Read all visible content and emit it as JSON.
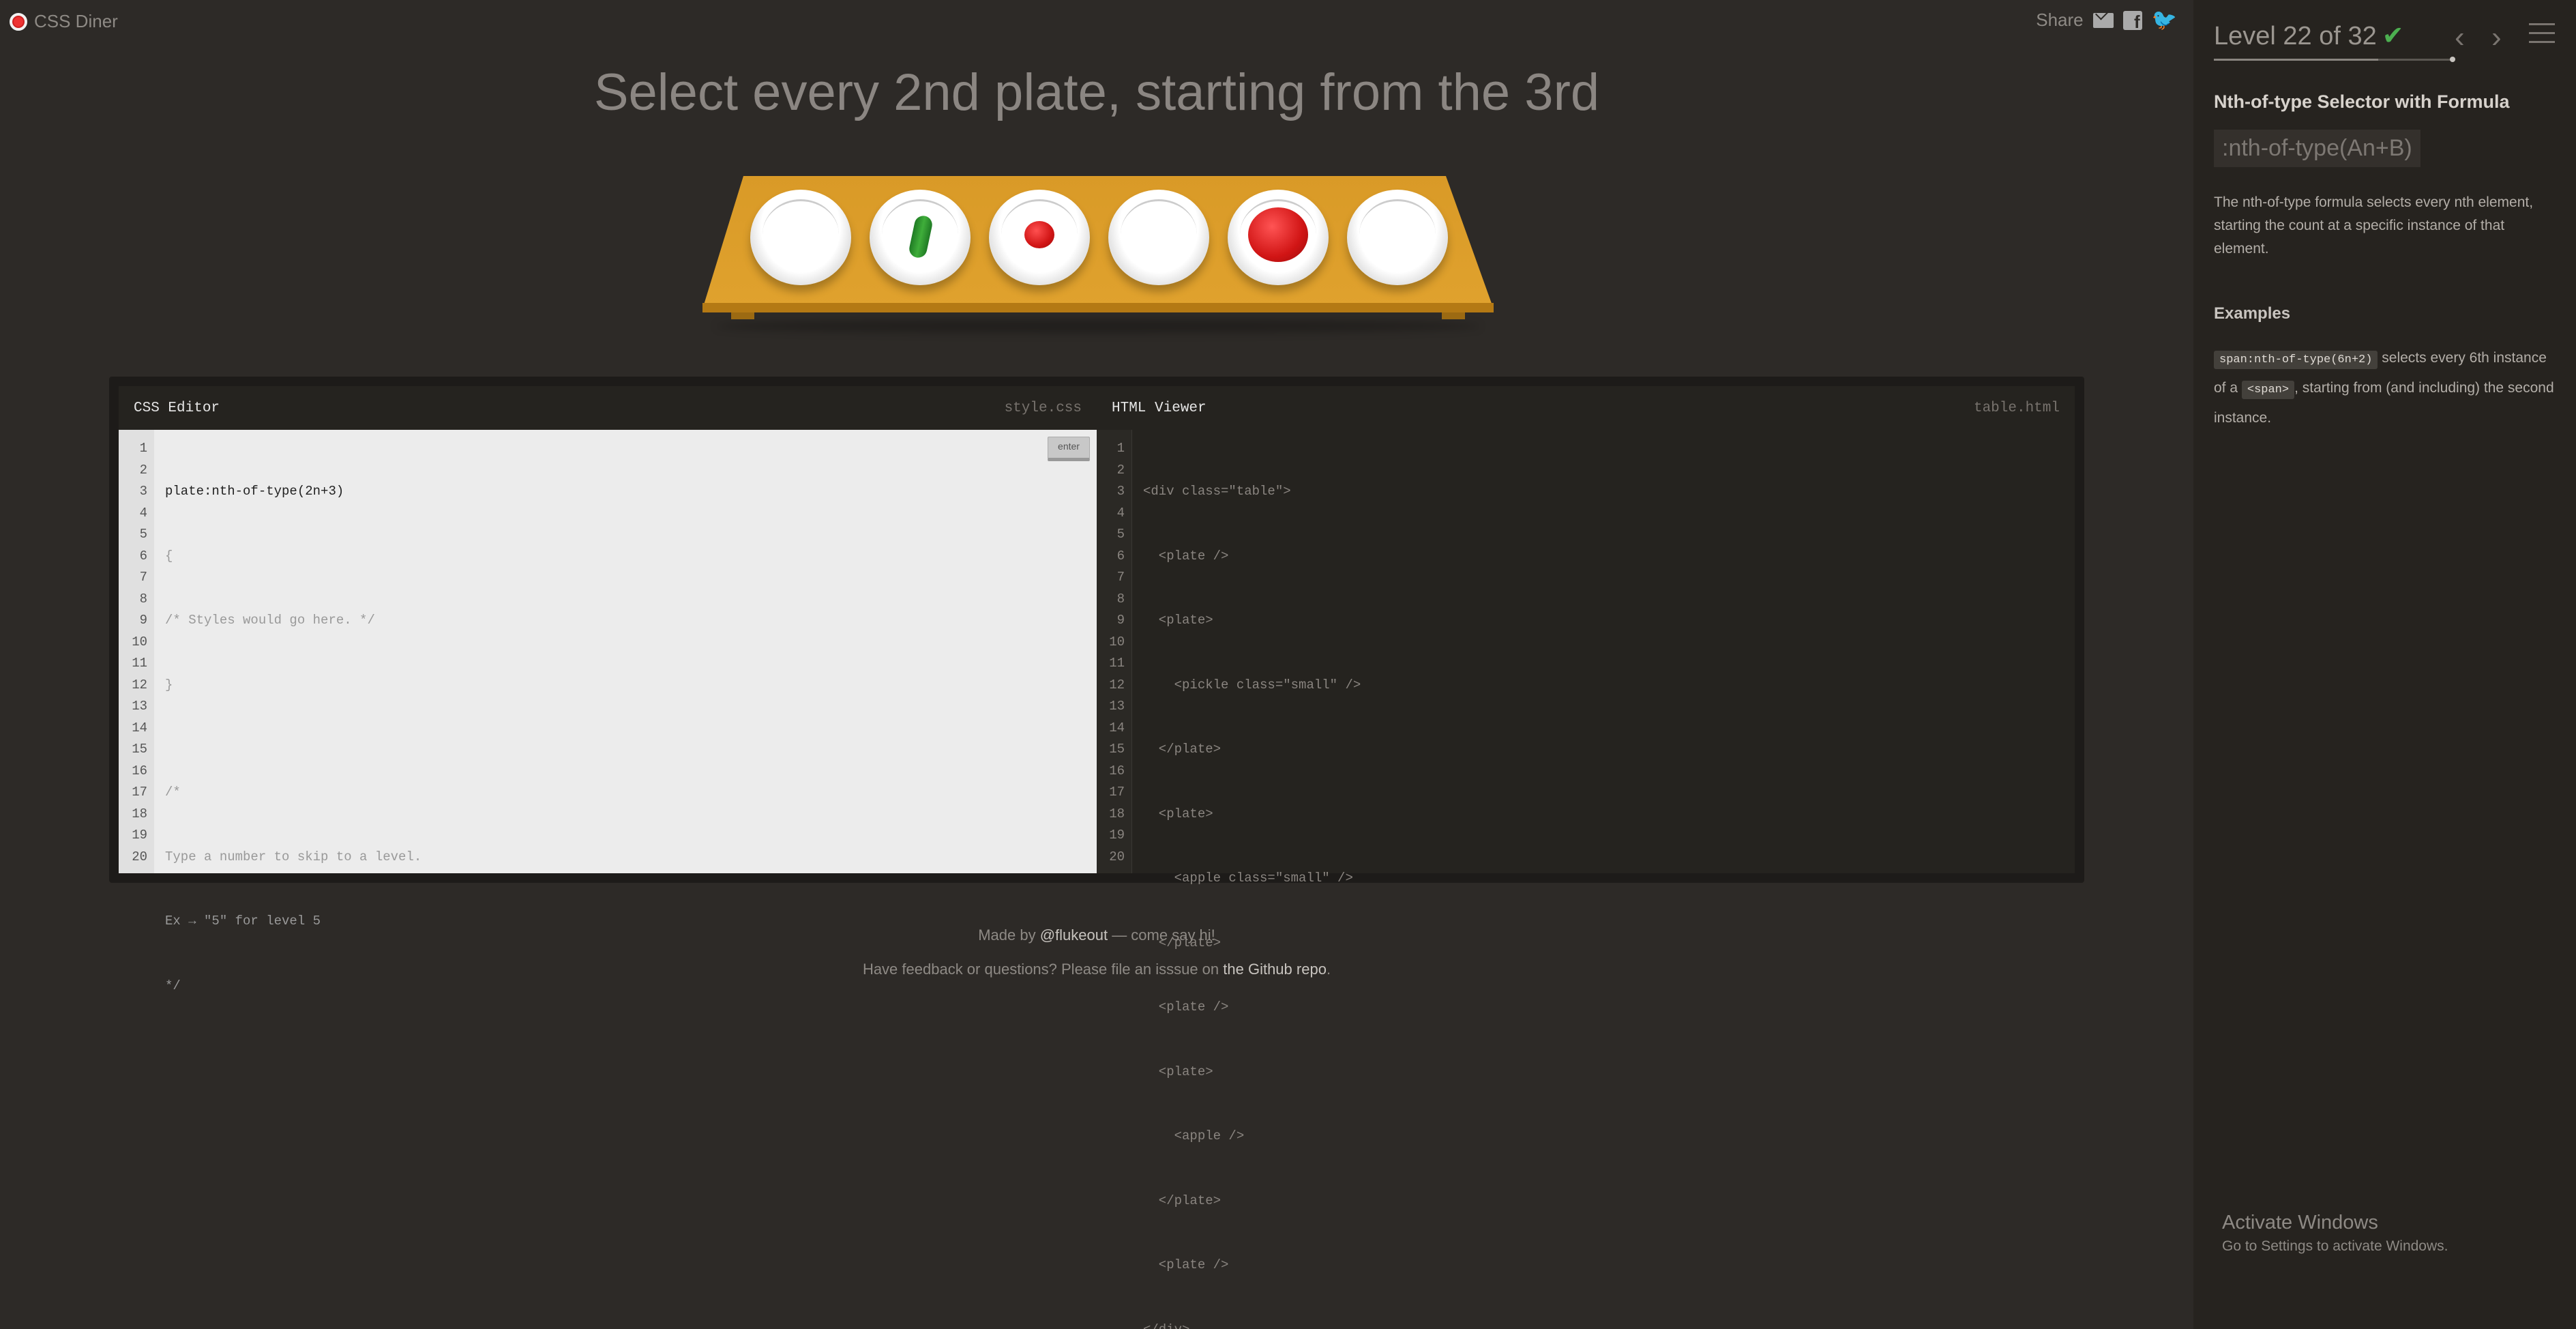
{
  "app": {
    "name": "CSS Diner"
  },
  "share": {
    "label": "Share"
  },
  "instruction": "Select every 2nd plate, starting from the 3rd",
  "table_items": [
    {
      "type": "plate",
      "contents": ""
    },
    {
      "type": "plate",
      "contents": "pickle"
    },
    {
      "type": "plate",
      "contents": "apple small"
    },
    {
      "type": "plate",
      "contents": ""
    },
    {
      "type": "plate",
      "contents": "apple"
    },
    {
      "type": "plate",
      "contents": ""
    }
  ],
  "css_editor": {
    "title": "CSS Editor",
    "file": "style.css",
    "enter_label": "enter",
    "input_value": "plate:nth-of-type(2n+3)",
    "lines": [
      "{",
      "/* Styles would go here. */",
      "}",
      "",
      "/*",
      "Type a number to skip to a level.",
      "Ex → \"5\" for level 5",
      "*/"
    ],
    "line_count": 20
  },
  "html_viewer": {
    "title": "HTML Viewer",
    "file": "table.html",
    "lines": [
      "<div class=\"table\">",
      "  <plate />",
      "  <plate>",
      "    <pickle class=\"small\" />",
      "  </plate>",
      "  <plate>",
      "    <apple class=\"small\" />",
      "  </plate>",
      "  <plate />",
      "  <plate>",
      "    <apple />",
      "  </plate>",
      "  <plate />",
      "</div>"
    ],
    "line_count": 20
  },
  "footer": {
    "made_by_prefix": "Made by ",
    "made_by_link": "@flukeout",
    "made_by_suffix": " — come say hi!",
    "feedback_prefix": "Have feedback or questions? Please file an isssue on ",
    "feedback_link": "the Github repo",
    "feedback_suffix": "."
  },
  "sidebar": {
    "level_text": "Level 22 of 32",
    "level_current": 22,
    "level_total": 32,
    "completed_mark": "✔",
    "prev_icon": "‹",
    "next_icon": "›",
    "selector_name": "Nth-of-type Selector with Formula",
    "syntax": ":nth-of-type(An+B)",
    "description": "The nth-of-type formula selects every nth element, starting the count at a specific instance of that element.",
    "examples_title": "Examples",
    "example_code1": "span:nth-of-type(6n+2)",
    "example_text1": " selects every 6th instance of a ",
    "example_code2": "<span>",
    "example_text2": ", starting from (and including) the second instance."
  },
  "windows": {
    "activate_title": "Activate Windows",
    "activate_sub": "Go to Settings to activate Windows."
  },
  "colors": {
    "background": "#2d2a27",
    "sidebar": "#26231f",
    "table": "#d99a27",
    "check": "#4caf50"
  }
}
